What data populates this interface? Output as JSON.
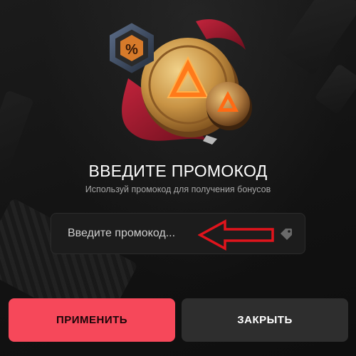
{
  "colors": {
    "accent": "#f6485a",
    "background": "#141414",
    "field_background": "#1c1c1c",
    "secondary_button": "#2e2e2e",
    "annotation_arrow": "#e0141c"
  },
  "hero": {
    "badge_symbol": "%",
    "coin_icon": "triangle-logo-icon"
  },
  "promo": {
    "title": "ВВЕДИТЕ ПРОМОКОД",
    "subtitle": "Используй промокод для получения бонусов",
    "input_placeholder": "Введите промокод...",
    "input_value": "",
    "field_icon": "tag-icon"
  },
  "actions": {
    "apply_label": "ПРИМЕНИТЬ",
    "close_label": "ЗАКРЫТЬ"
  }
}
